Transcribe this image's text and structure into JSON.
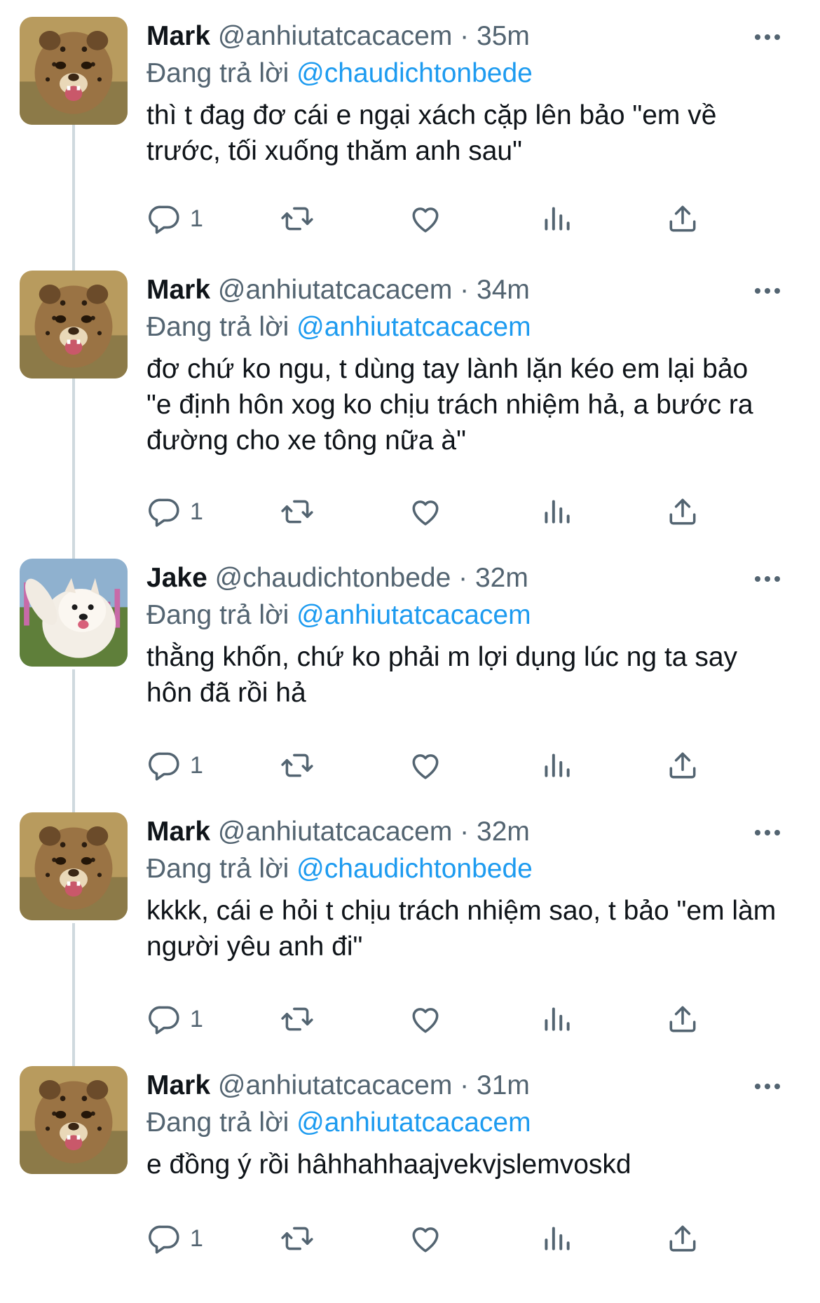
{
  "labels": {
    "replying_to": "Đang trả lời"
  },
  "colors": {
    "accent": "#1d9bf0",
    "muted": "#536471",
    "text": "#0f1419",
    "thread_line": "#cfd9de"
  },
  "icons": {
    "more": "more-horizontal-icon",
    "reply": "reply-icon",
    "retweet": "retweet-icon",
    "like": "heart-icon",
    "views": "views-icon",
    "share": "share-icon"
  },
  "tweets": [
    {
      "author": "Mark",
      "handle": "@anhiutatcacacem",
      "separator": "·",
      "time": "35m",
      "avatar": "cheetah-cub-avatar",
      "reply_to": "@chaudichtonbede",
      "text": "thì t đag đơ cái e ngại xách cặp lên bảo \"em về trước, tối xuống thăm anh sau\"",
      "reply_count": "1"
    },
    {
      "author": "Mark",
      "handle": "@anhiutatcacacem",
      "separator": "·",
      "time": "34m",
      "avatar": "cheetah-cub-avatar",
      "reply_to": "@anhiutatcacacem",
      "text": "đơ chứ ko ngu, t dùng tay lành lặn kéo em lại bảo \"e định hôn xog ko chịu trách nhiệm hả, a bước ra đường cho xe tông nữa à\"",
      "reply_count": "1"
    },
    {
      "author": "Jake",
      "handle": "@chaudichtonbede",
      "separator": "·",
      "time": "32m",
      "avatar": "samoyed-dog-avatar",
      "reply_to": "@anhiutatcacacem",
      "text": "thằng khốn, chứ ko phải m lợi dụng lúc ng ta say hôn đã rồi hả",
      "reply_count": "1"
    },
    {
      "author": "Mark",
      "handle": "@anhiutatcacacem",
      "separator": "·",
      "time": "32m",
      "avatar": "cheetah-cub-avatar",
      "reply_to": "@chaudichtonbede",
      "text": "kkkk, cái e hỏi t chịu trách nhiệm sao, t bảo \"em làm người yêu anh đi\"",
      "reply_count": "1"
    },
    {
      "author": "Mark",
      "handle": "@anhiutatcacacem",
      "separator": "·",
      "time": "31m",
      "avatar": "cheetah-cub-avatar",
      "reply_to": "@anhiutatcacacem",
      "text": "e đồng ý rồi hâhhahhaajvekvjslemvoskd",
      "reply_count": "1"
    }
  ]
}
